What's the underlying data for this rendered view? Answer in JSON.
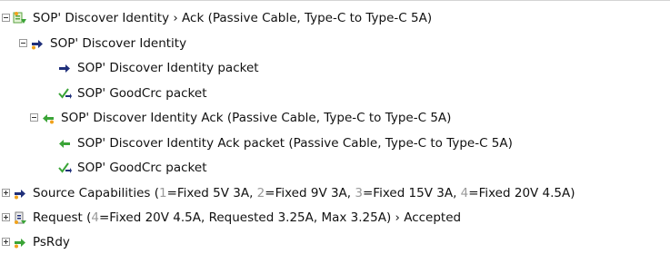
{
  "tree": {
    "row0": {
      "label": "SOP' Discover Identity › Ack (Passive Cable, Type-C to Type-C 5A)",
      "icon": "transaction-green-icon",
      "toggle": "expanded"
    },
    "row1": {
      "label": "SOP' Discover Identity",
      "icon": "arrow-right-orange-dot-icon",
      "toggle": "expanded"
    },
    "row2": {
      "label": "SOP' Discover Identity packet",
      "icon": "arrow-right-navy-icon"
    },
    "row3": {
      "label": "SOP' GoodCrc packet",
      "icon": "check-arrow-icon"
    },
    "row4": {
      "label": "SOP' Discover Identity Ack (Passive Cable, Type-C to Type-C 5A)",
      "icon": "arrow-left-green-dot-icon",
      "toggle": "expanded"
    },
    "row5": {
      "label": "SOP' Discover Identity Ack packet (Passive Cable, Type-C to Type-C 5A)",
      "icon": "arrow-left-green-icon"
    },
    "row6": {
      "label": "SOP' GoodCrc packet",
      "icon": "check-arrow-icon"
    },
    "row7": {
      "label_prefix": "Source Capabilities (",
      "i1": "1",
      "t1": "=Fixed 5V 3A, ",
      "i2": "2",
      "t2": "=Fixed 9V 3A, ",
      "i3": "3",
      "t3": "=Fixed 15V 3A, ",
      "i4": "4",
      "t4": "=Fixed 20V 4.5A)",
      "icon": "arrow-right-navy-orange-dot-icon",
      "toggle": "collapsed"
    },
    "row8": {
      "label_prefix": "Request (",
      "i4": "4",
      "label_suffix": "=Fixed 20V 4.5A, Requested 3.25A, Max 3.25A) › Accepted",
      "icon": "request-icon",
      "toggle": "collapsed"
    },
    "row9": {
      "label": "PsRdy",
      "icon": "arrow-right-green-orange-dot-icon",
      "toggle": "collapsed"
    }
  },
  "colors": {
    "navy": "#1f2f7a",
    "green": "#3aa437",
    "orange": "#f0a21b",
    "index_gray": "#9a9a9a"
  }
}
